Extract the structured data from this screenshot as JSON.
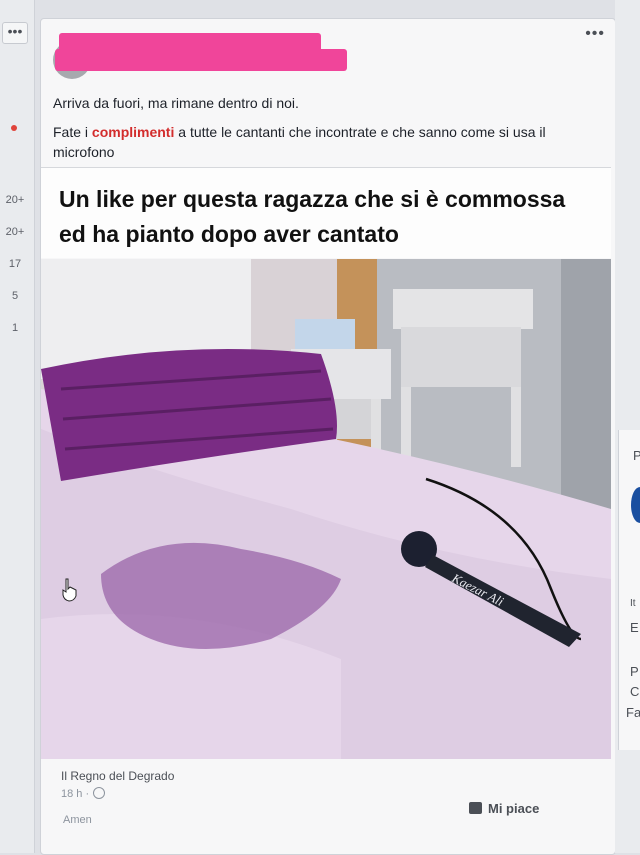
{
  "rail": {
    "menu_label": "•••",
    "counts": [
      "20+",
      "20+",
      "17",
      "5",
      "1"
    ]
  },
  "post": {
    "menu_label": "•••",
    "line1": "Arriva da fuori, ma rimane dentro di noi.",
    "line2_before": "Fate i ",
    "line2_highlight": "complimenti",
    "line2_after": " a tutte le cantanti che incontrate e che sanno come si usa il microfono",
    "caption_line1": "Un like per questa ragazza che si è commossa",
    "caption_line2": "ed ha pianto dopo aver cantato",
    "mic_brand": "Kaezar Ali",
    "page_name": "Il Regno del Degrado",
    "time": "18 h ·",
    "like_label": "Mi piace",
    "comment_hint": "Amen"
  },
  "right_side": {
    "letters": [
      "P",
      "It",
      "E",
      "P",
      "C",
      "Fa"
    ]
  },
  "colors": {
    "highlight": "#d32d2d",
    "redaction": "#f0459a",
    "sheet": "#e6d6ea",
    "pillow": "#7a2c84"
  }
}
